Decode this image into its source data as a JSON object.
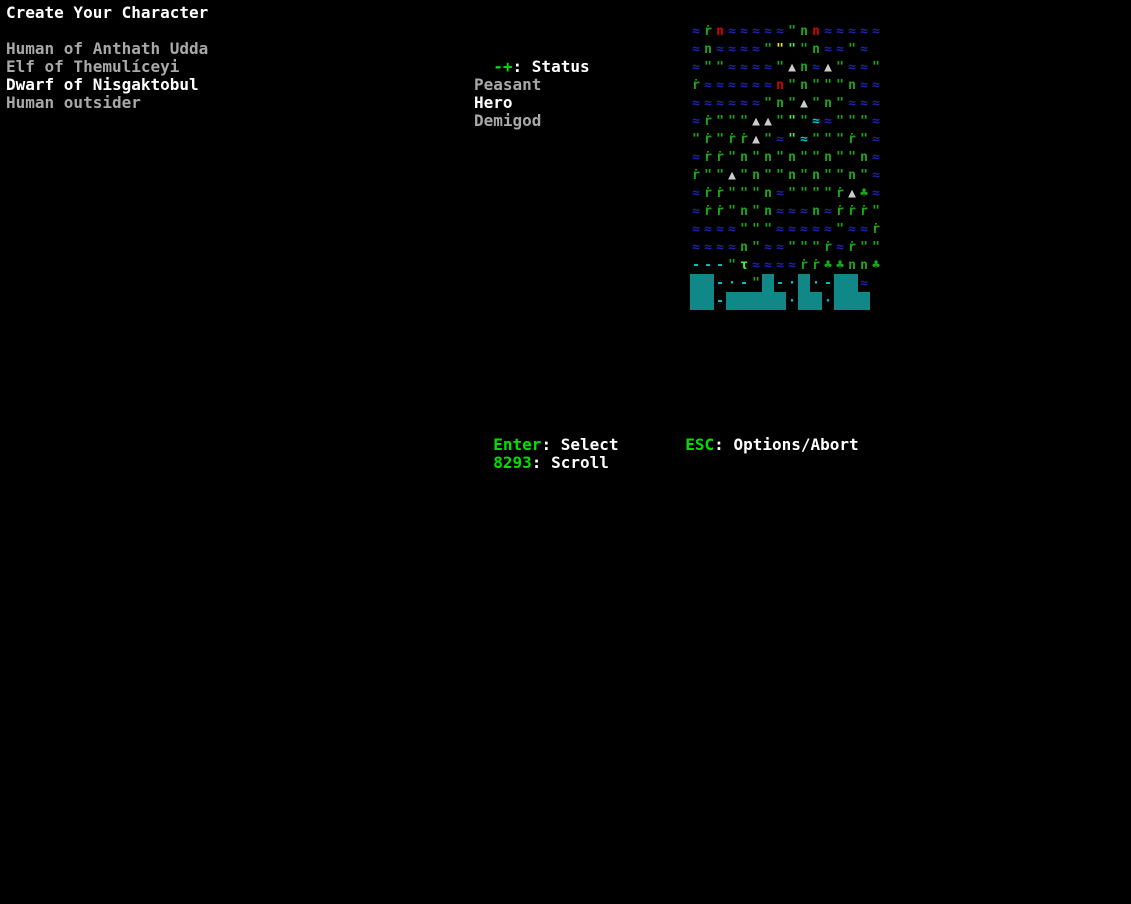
{
  "title": "Create Your Character",
  "races": [
    {
      "label": "Human of Anthath Udda",
      "selected": false
    },
    {
      "label": "Elf of Themulíceyi",
      "selected": false
    },
    {
      "label": "Dwarf of Nisgaktobul",
      "selected": true
    },
    {
      "label": "Human outsider",
      "selected": false
    }
  ],
  "status_hint": {
    "key": "-+",
    "text": ": Status"
  },
  "statuses": [
    {
      "label": "Peasant",
      "selected": false
    },
    {
      "label": "Hero",
      "selected": true
    },
    {
      "label": "Demigod",
      "selected": false
    }
  ],
  "controls": {
    "enter_key": "Enter",
    "enter_text": ": Select",
    "esc_key": "ESC",
    "esc_text": ": Options/Abort",
    "scroll_key": "8293",
    "scroll_text": ": Scroll"
  },
  "map_tiles": {
    "colors": {
      "water": "#2222aa",
      "grass": "#1aa81a",
      "bright_grass": "#44ee44",
      "mountain": "#cccccc",
      "cyan": "#00c8c8",
      "yellow": "#eeee00",
      "red": "#d00000",
      "blue": "#3333ff",
      "grey": "#a8a8a8"
    }
  }
}
